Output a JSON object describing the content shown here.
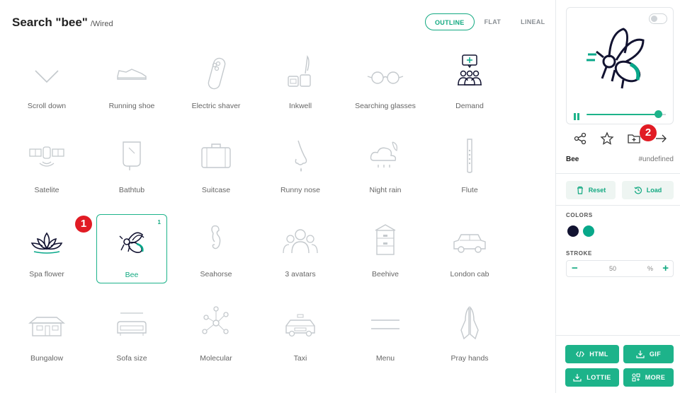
{
  "header": {
    "title": "Search \"bee\"",
    "subtitle": "/Wired"
  },
  "styles": [
    "OUTLINE",
    "FLAT",
    "LINEAL"
  ],
  "icons": [
    {
      "label": "Scroll down"
    },
    {
      "label": "Running shoe"
    },
    {
      "label": "Electric shaver"
    },
    {
      "label": "Inkwell"
    },
    {
      "label": "Searching glasses"
    },
    {
      "label": "Demand"
    },
    {
      "label": "Satelite"
    },
    {
      "label": "Bathtub"
    },
    {
      "label": "Suitcase"
    },
    {
      "label": "Runny nose"
    },
    {
      "label": "Night rain"
    },
    {
      "label": "Flute"
    },
    {
      "label": "Spa flower"
    },
    {
      "label": "Bee",
      "count": "1"
    },
    {
      "label": "Seahorse"
    },
    {
      "label": "3 avatars"
    },
    {
      "label": "Beehive"
    },
    {
      "label": "London cab"
    },
    {
      "label": "Bungalow"
    },
    {
      "label": "Sofa size"
    },
    {
      "label": "Molecular"
    },
    {
      "label": "Taxi"
    },
    {
      "label": "Menu"
    },
    {
      "label": "Pray hands"
    }
  ],
  "markers": {
    "one": "1",
    "two": "2"
  },
  "panel": {
    "name": "Bee",
    "tag": "#undefined",
    "progress": 0.9,
    "reset": "Reset",
    "load": "Load",
    "colors_label": "COLORS",
    "colors": [
      "#121331",
      "#08a88a"
    ],
    "stroke_label": "STROKE",
    "stroke_value": "50",
    "stroke_unit": "%",
    "minus": "−",
    "plus": "+",
    "buttons": {
      "html": "HTML",
      "gif": "GIF",
      "lottie": "LOTTIE",
      "more": "MORE"
    }
  }
}
